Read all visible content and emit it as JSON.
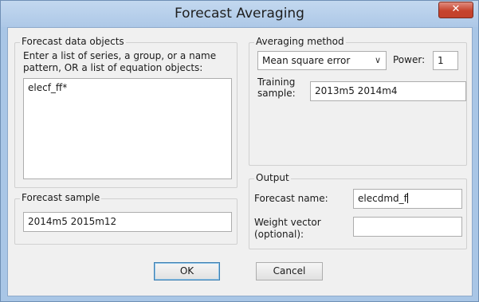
{
  "window": {
    "title": "Forecast Averaging",
    "close_glyph": "✕"
  },
  "forecast_data": {
    "legend": "Forecast data objects",
    "instructions": "Enter a list of series, a group, or a name pattern, OR a list of equation objects:",
    "value": "elecf_ff*"
  },
  "averaging": {
    "legend": "Averaging method",
    "method_selected": "Mean square error",
    "power_label": "Power:",
    "power_value": "1",
    "training_label": "Training sample:",
    "training_value": "2013m5 2014m4"
  },
  "forecast_sample": {
    "legend": "Forecast sample",
    "value": "2014m5 2015m12"
  },
  "output": {
    "legend": "Output",
    "forecast_name_label": "Forecast name:",
    "forecast_name_value": "elecdmd_f",
    "weight_label": "Weight vector (optional):",
    "weight_value": ""
  },
  "buttons": {
    "ok": "OK",
    "cancel": "Cancel"
  },
  "colors": {
    "title_bar": "#adc8e7",
    "close": "#c6432d",
    "dialog_bg": "#f0f0f0",
    "default_border": "#3c7fb1"
  }
}
